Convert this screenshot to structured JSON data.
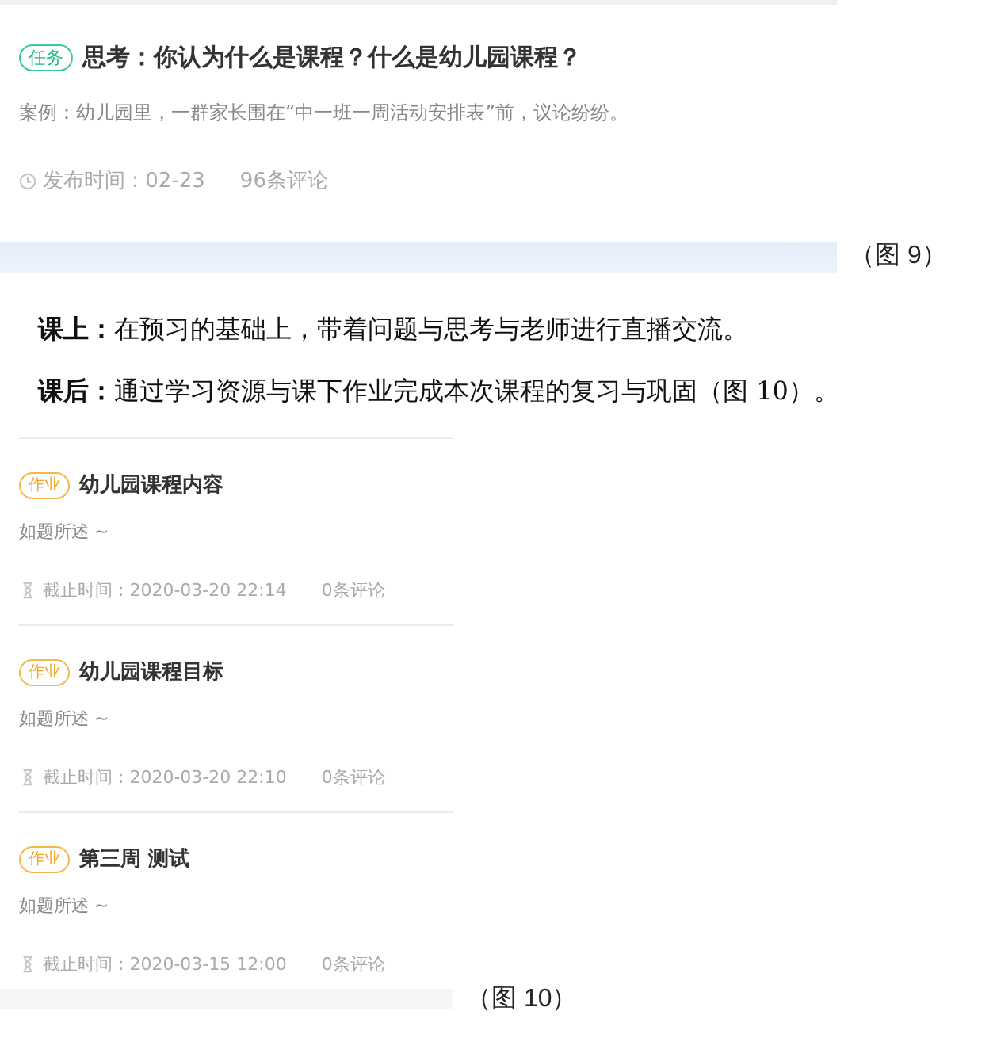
{
  "figure_9": {
    "task": {
      "tag": "任务",
      "title": "思考：你认为什么是课程？什么是幼儿园课程？",
      "description": "案例：幼儿园里，一群家长围在“中一班一周活动安排表”前，议论纷纷。",
      "published": "发布时间 : 02-23",
      "comments": "96条评论"
    },
    "caption": "（图 9）"
  },
  "paragraphs": [
    {
      "text": "**课上：**在预习的基础上，带着问题与思考与老师进行直播交流。"
    },
    {
      "text": "**课后：**通过学习资源与课下作业完成本次课程的复习与巩固（图 10）。"
    }
  ],
  "figure_10": {
    "items": [
      {
        "tag": "作业",
        "title": "幼儿园课程内容",
        "description": "如题所述 ~",
        "deadline": "截止时间 : 2020-03-20 22:14",
        "comments": "0条评论"
      },
      {
        "tag": "作业",
        "title": "幼儿园课程目标",
        "description": "如题所述 ~",
        "deadline": "截止时间 : 2020-03-20 22:10",
        "comments": "0条评论"
      },
      {
        "tag": "作业",
        "title": "第三周 测试",
        "description": "如题所述 ~",
        "deadline": "截止时间 : 2020-03-15 12:00",
        "comments": "0条评论"
      }
    ],
    "caption": "（图 10）"
  }
}
